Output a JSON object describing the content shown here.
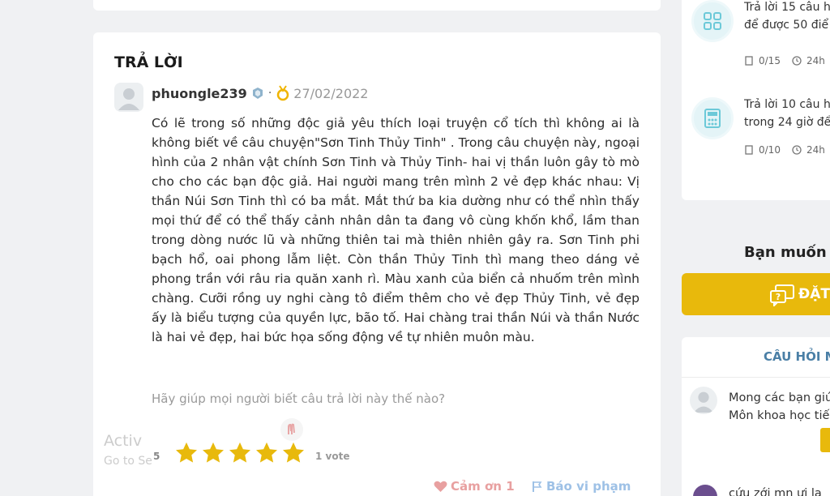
{
  "answer": {
    "heading": "TRẢ LỜI",
    "username": "phuongle239",
    "separator": "·",
    "date": "27/02/2022",
    "body": "Có lẽ trong số những độc giả yêu thích loại truyện cổ tích thì không ai là không biết về câu chuyện\"Sơn Tinh Thủy Tinh\" . Trong câu chuyện này, ngoại hình của 2 nhân vật chính Sơn Tinh và Thủy Tinh- hai vị thần luôn gây tò mò cho cho các bạn độc giả. Hai người mang trên mình 2 vẻ đẹp khác nhau: Vị thần Núi Sơn Tinh thì có ba mắt. Mắt thứ ba kia dường như có thể nhìn thấy mọi thứ để có thể thấy cảnh nhân dân ta đang vô cùng khốn khổ, lầm than trong dòng nước lũ và những thiên tai mà thiên nhiên gây ra. Sơn Tinh phi bạch hổ, oai phong lẫm liệt. Còn thần Thủy Tinh thì mang theo dáng vẻ phong trần với râu ria quăn xanh rì. Màu xanh của biển cả nhuốm trên mình chàng. Cưỡi rồng uy nghi càng tô điểm thêm cho vẻ đẹp Thủy Tinh, vẻ đẹp ấy là biểu tượng của quyền lực, bão tố. Hai chàng trai thần Núi và thần Nước là hai vẻ đẹp, hai bức họa sống động về tự nhiên muôn màu.",
    "rate_prompt": "Hãy giúp mọi người biết câu trả lời này thế nào?",
    "rating": "5",
    "stars_filled": 5,
    "votes": "1 vote",
    "thanks_label": "Cảm ơn 1",
    "report_label": "Báo vi phạm"
  },
  "sidebar": {
    "tasks": [
      {
        "text": "Trả lời 15 câu h\nđể được 50 điể",
        "progress": "0/15",
        "time": "24h",
        "icon": "grid-icon"
      },
      {
        "text": "Trả lời 10 câu h\ntrong 24 giờ để",
        "progress": "0/10",
        "time": "24h",
        "icon": "calculator-icon"
      }
    ],
    "ask_title": "Bạn muốn h",
    "ask_button": "ĐẶT",
    "recent_heading": "CÂU HỎI M",
    "recent_question": "Mong các bạn giú\nMôn khoa học tiế",
    "activate_title": "Activ",
    "activate_sub": "Go to Se",
    "recent_question_2": "cứu zới mn ưi la"
  },
  "colors": {
    "star": "#e8b90c",
    "ask_button": "#e8b90c",
    "thanks": "#e8a0a0",
    "report": "#9ec1e6",
    "recent_heading": "#4a7fa6"
  }
}
